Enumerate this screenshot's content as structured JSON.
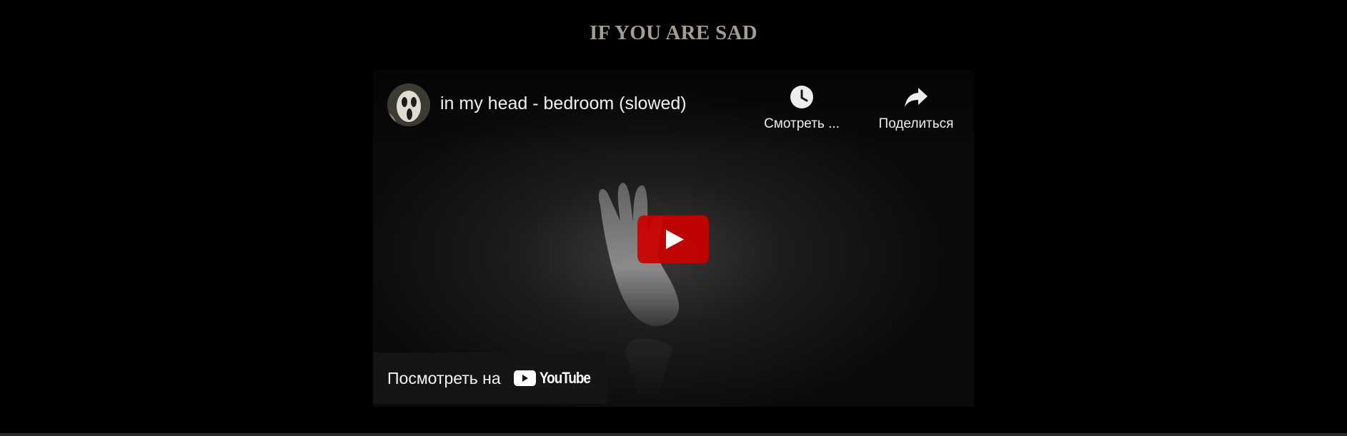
{
  "page": {
    "title": "IF YOU ARE SAD",
    "background_color": "#000000",
    "title_color": "#a59c92"
  },
  "player": {
    "video_title": "in my head - bedroom (slowed)",
    "channel_avatar": "channel-avatar-image",
    "actions": [
      {
        "label": "Смотреть ...",
        "icon": "clock-icon"
      },
      {
        "label": "Поделиться",
        "icon": "share-arrow-icon"
      }
    ],
    "play_button": {
      "icon": "play-icon",
      "color": "#cc0000"
    },
    "watch_on": {
      "label": "Посмотреть на",
      "logo_text": "YouTube",
      "logo_icon": "youtube-logo-icon"
    }
  }
}
